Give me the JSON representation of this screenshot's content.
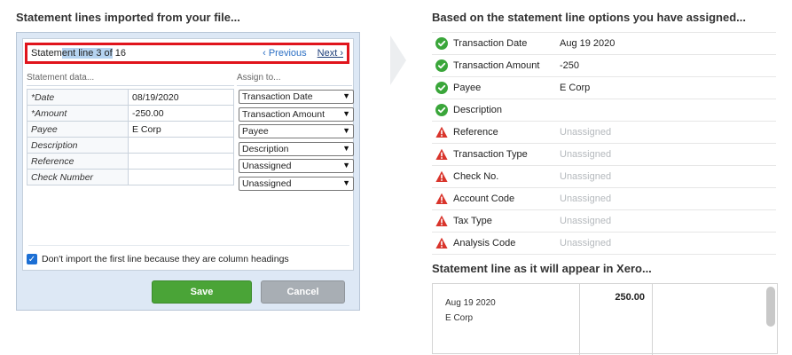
{
  "left": {
    "heading": "Statement lines imported from your file...",
    "nav": {
      "title_prefix": "Statem",
      "title_highlight": "ent line 3 of",
      "title_suffix": " 16",
      "previous": "‹ Previous",
      "next": "Next ›"
    },
    "columns": {
      "statement": "Statement data...",
      "assign": "Assign to..."
    },
    "rows": [
      {
        "label": "*Date",
        "value": "08/19/2020",
        "assign": "Transaction Date"
      },
      {
        "label": "*Amount",
        "value": "-250.00",
        "assign": "Transaction Amount"
      },
      {
        "label": "Payee",
        "value": "E Corp",
        "assign": "Payee"
      },
      {
        "label": "Description",
        "value": "",
        "assign": "Description"
      },
      {
        "label": "Reference",
        "value": "",
        "assign": "Unassigned"
      },
      {
        "label": "Check Number",
        "value": "",
        "assign": "Unassigned"
      }
    ],
    "checkbox_label": "Don't import the first line because they are column headings",
    "save": "Save",
    "cancel": "Cancel"
  },
  "right": {
    "heading": "Based on the statement line options you have assigned...",
    "mappings": [
      {
        "name": "Transaction Date",
        "value": "Aug 19 2020",
        "status": "ok"
      },
      {
        "name": "Transaction Amount",
        "value": "-250",
        "status": "ok"
      },
      {
        "name": "Payee",
        "value": "E Corp",
        "status": "ok"
      },
      {
        "name": "Description",
        "value": "",
        "status": "ok"
      },
      {
        "name": "Reference",
        "value": "Unassigned",
        "status": "warn"
      },
      {
        "name": "Transaction Type",
        "value": "Unassigned",
        "status": "warn"
      },
      {
        "name": "Check No.",
        "value": "Unassigned",
        "status": "warn"
      },
      {
        "name": "Account Code",
        "value": "Unassigned",
        "status": "warn"
      },
      {
        "name": "Tax Type",
        "value": "Unassigned",
        "status": "warn"
      },
      {
        "name": "Analysis Code",
        "value": "Unassigned",
        "status": "warn"
      }
    ],
    "preview_heading": "Statement line as it will appear in Xero...",
    "preview": {
      "date": "Aug 19 2020",
      "payee": "E Corp",
      "amount": "250.00"
    }
  },
  "colors": {
    "ok": "#3aa63a",
    "warn": "#d9342b",
    "save": "#4aa437",
    "cancel": "#a8aeb4",
    "nav_border": "#e0141c"
  }
}
